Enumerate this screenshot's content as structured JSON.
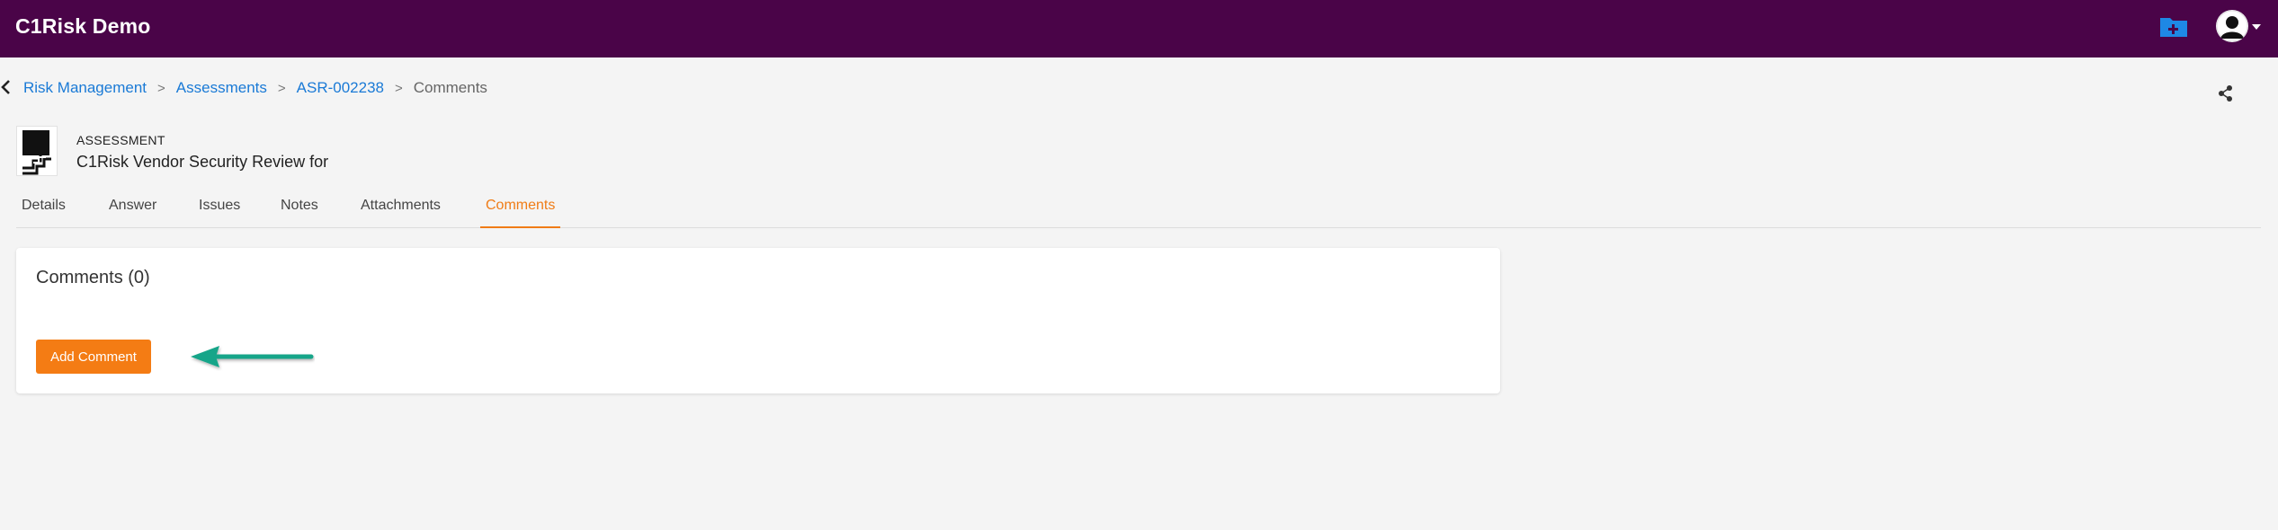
{
  "app": {
    "title": "C1Risk Demo"
  },
  "header": {
    "icons": [
      "new-folder-icon",
      "user-avatar-icon",
      "caret-down-icon"
    ]
  },
  "breadcrumb": {
    "items": [
      "Risk Management",
      "Assessments",
      "ASR-002238"
    ],
    "separator": ">",
    "current": "Comments"
  },
  "record": {
    "type": "ASSESSMENT",
    "name": "C1Risk Vendor Security Review for"
  },
  "tabs": [
    {
      "label": "Details"
    },
    {
      "label": "Answer"
    },
    {
      "label": "Issues"
    },
    {
      "label": "Notes"
    },
    {
      "label": "Attachments"
    },
    {
      "label": "Comments",
      "active": true
    }
  ],
  "comments": {
    "title": "Comments (0)",
    "add_label": "Add Comment"
  },
  "colors": {
    "topbar": "#4a0448",
    "accent": "#f47c14",
    "link": "#1a7ad6",
    "folder_icon": "#1e88e5",
    "annotation_arrow": "#17a589"
  }
}
